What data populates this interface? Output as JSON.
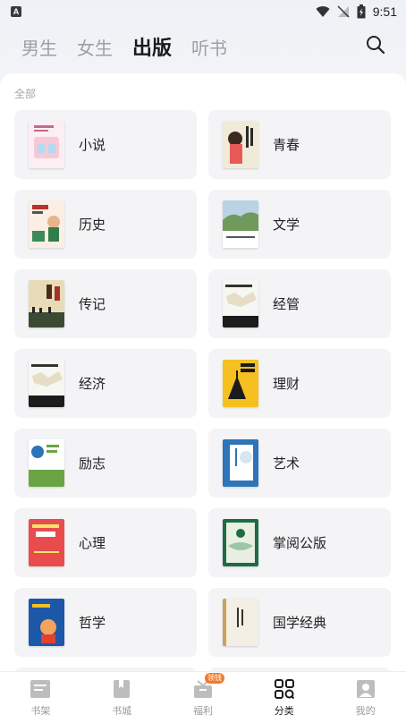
{
  "status_bar": {
    "time": "9:51",
    "app_badge": "A"
  },
  "header": {
    "tabs": [
      {
        "label": "男生",
        "active": false
      },
      {
        "label": "女生",
        "active": false
      },
      {
        "label": "出版",
        "active": true
      },
      {
        "label": "听书",
        "active": false
      }
    ],
    "search_icon": "search-icon"
  },
  "section": {
    "title": "全部"
  },
  "categories": [
    {
      "label": "小说",
      "cover_color": "#f7c9d6"
    },
    {
      "label": "青春",
      "cover_color": "#f2ead8"
    },
    {
      "label": "历史",
      "cover_color": "#f6dcc7"
    },
    {
      "label": "文学",
      "cover_color": "#7fa86c"
    },
    {
      "label": "传记",
      "cover_color": "#d9c79a"
    },
    {
      "label": "经管",
      "cover_color": "#1e1e1e"
    },
    {
      "label": "经济",
      "cover_color": "#1e1e1e"
    },
    {
      "label": "理财",
      "cover_color": "#f5c020"
    },
    {
      "label": "励志",
      "cover_color": "#6aa443"
    },
    {
      "label": "艺术",
      "cover_color": "#2d74b8"
    },
    {
      "label": "心理",
      "cover_color": "#e94c4c"
    },
    {
      "label": "掌阅公版",
      "cover_color": "#1e6b44"
    },
    {
      "label": "哲学",
      "cover_color": "#1d57a8"
    },
    {
      "label": "国学经典",
      "cover_color": "#f3efe4"
    }
  ],
  "bottom_nav": {
    "items": [
      {
        "label": "书架",
        "icon": "bookshelf-icon",
        "active": false
      },
      {
        "label": "书城",
        "icon": "bookstore-icon",
        "active": false
      },
      {
        "label": "福利",
        "icon": "gift-icon",
        "active": false,
        "badge": "领钱"
      },
      {
        "label": "分类",
        "icon": "category-icon",
        "active": true
      },
      {
        "label": "我的",
        "icon": "profile-icon",
        "active": false
      }
    ]
  },
  "colors": {
    "active_text": "#1a1a1a",
    "inactive_tab": "#9aa0a8",
    "card_bg": "#f4f4f6",
    "badge": "#f07a2c"
  }
}
